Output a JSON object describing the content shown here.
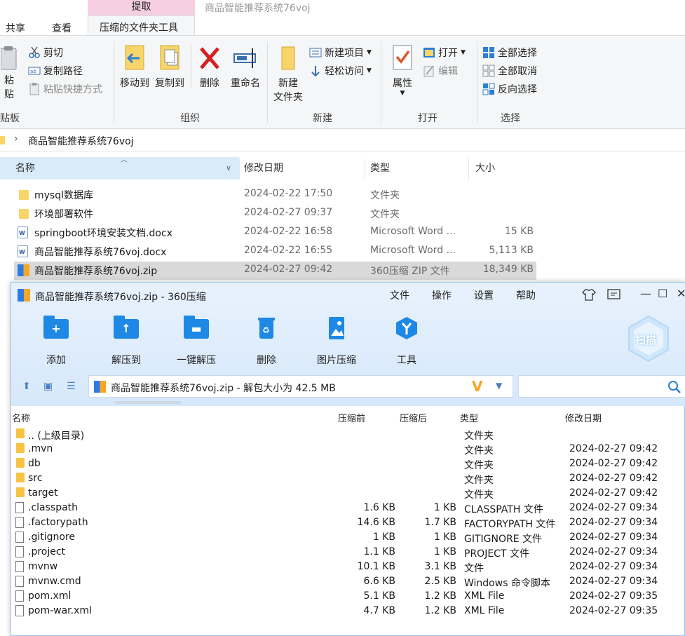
{
  "explorer": {
    "context_tab_head": "提取",
    "window_title": "商品智能推荐系统76voj",
    "tabs": [
      {
        "label": "共享"
      },
      {
        "label": "查看"
      },
      {
        "label": "压缩的文件夹工具"
      }
    ],
    "clipboard": {
      "paste_partial": "粘贴",
      "cut": "剪切",
      "copy_path": "复制路径",
      "paste_shortcut": "粘贴快捷方式",
      "group_partial": "贴板"
    },
    "organize": {
      "move_to": "移动到",
      "copy_to": "复制到",
      "delete": "删除",
      "rename": "重命名",
      "group": "组织"
    },
    "new": {
      "new_folder_line1": "新建",
      "new_folder_line2": "文件夹",
      "new_item": "新建项目",
      "easy_access": "轻松访问",
      "group": "新建"
    },
    "open": {
      "properties": "属性",
      "open": "打开",
      "edit": "编辑",
      "group": "打开"
    },
    "select": {
      "select_all": "全部选择",
      "select_none": "全部取消",
      "invert": "反向选择",
      "group": "选择"
    },
    "address": "商品智能推荐系统76voj",
    "columns": {
      "name": "名称",
      "date": "修改日期",
      "type": "类型",
      "size": "大小"
    },
    "files": [
      {
        "name": "mysql数据库",
        "date": "2024-02-22 17:50",
        "type": "文件夹",
        "size": "",
        "icon": "folder-icon"
      },
      {
        "name": "环境部署软件",
        "date": "2024-02-27 09:37",
        "type": "文件夹",
        "size": "",
        "icon": "folder-icon"
      },
      {
        "name": "springboot环境安装文档.docx",
        "date": "2024-02-22 16:58",
        "type": "Microsoft Word ...",
        "size": "15 KB",
        "icon": "word-doc-icon"
      },
      {
        "name": "商品智能推荐系统76voj.docx",
        "date": "2024-02-22 16:55",
        "type": "Microsoft Word ...",
        "size": "5,113 KB",
        "icon": "word-doc-icon"
      },
      {
        "name": "商品智能推荐系统76voj.zip",
        "date": "2024-02-27 09:42",
        "type": "360压缩 ZIP 文件",
        "size": "18,349 KB",
        "icon": "zip-archive-icon"
      }
    ]
  },
  "zip": {
    "title": "商品智能推荐系统76voj.zip - 360压缩",
    "menu": [
      "文件",
      "操作",
      "设置",
      "帮助"
    ],
    "tools": [
      "添加",
      "解压到",
      "一键解压",
      "删除",
      "图片压缩",
      "工具"
    ],
    "scan": "扫描",
    "path": "商品智能推荐系统76voj.zip - 解包大小为 42.5 MB",
    "columns": {
      "name": "名称",
      "before": "压缩前",
      "after": "压缩后",
      "type": "类型",
      "date": "修改日期"
    },
    "rows": [
      {
        "name": ".. (上级目录)",
        "before": "",
        "after": "",
        "type": "文件夹",
        "date": "",
        "icon": "folder-icon"
      },
      {
        "name": ".mvn",
        "before": "",
        "after": "",
        "type": "文件夹",
        "date": "2024-02-27 09:42",
        "icon": "folder-icon"
      },
      {
        "name": "db",
        "before": "",
        "after": "",
        "type": "文件夹",
        "date": "2024-02-27 09:42",
        "icon": "folder-icon"
      },
      {
        "name": "src",
        "before": "",
        "after": "",
        "type": "文件夹",
        "date": "2024-02-27 09:42",
        "icon": "folder-icon"
      },
      {
        "name": "target",
        "before": "",
        "after": "",
        "type": "文件夹",
        "date": "2024-02-27 09:42",
        "icon": "folder-icon"
      },
      {
        "name": ".classpath",
        "before": "1.6 KB",
        "after": "1 KB",
        "type": "CLASSPATH 文件",
        "date": "2024-02-27 09:34",
        "icon": "file-icon"
      },
      {
        "name": ".factorypath",
        "before": "14.6 KB",
        "after": "1.7 KB",
        "type": "FACTORYPATH 文件",
        "date": "2024-02-27 09:34",
        "icon": "file-icon"
      },
      {
        "name": ".gitignore",
        "before": "1 KB",
        "after": "1 KB",
        "type": "GITIGNORE 文件",
        "date": "2024-02-27 09:34",
        "icon": "file-icon"
      },
      {
        "name": ".project",
        "before": "1.1 KB",
        "after": "1 KB",
        "type": "PROJECT 文件",
        "date": "2024-02-27 09:34",
        "icon": "file-icon"
      },
      {
        "name": "mvnw",
        "before": "10.1 KB",
        "after": "3.1 KB",
        "type": "文件",
        "date": "2024-02-27 09:34",
        "icon": "file-icon"
      },
      {
        "name": "mvnw.cmd",
        "before": "6.6 KB",
        "after": "2.5 KB",
        "type": "Windows 命令脚本",
        "date": "2024-02-27 09:34",
        "icon": "cmd-script-icon"
      },
      {
        "name": "pom.xml",
        "before": "5.1 KB",
        "after": "1.2 KB",
        "type": "XML File",
        "date": "2024-02-27 09:35",
        "icon": "file-icon"
      },
      {
        "name": "pom-war.xml",
        "before": "4.7 KB",
        "after": "1.2 KB",
        "type": "XML File",
        "date": "2024-02-27 09:35",
        "icon": "file-icon"
      }
    ]
  }
}
